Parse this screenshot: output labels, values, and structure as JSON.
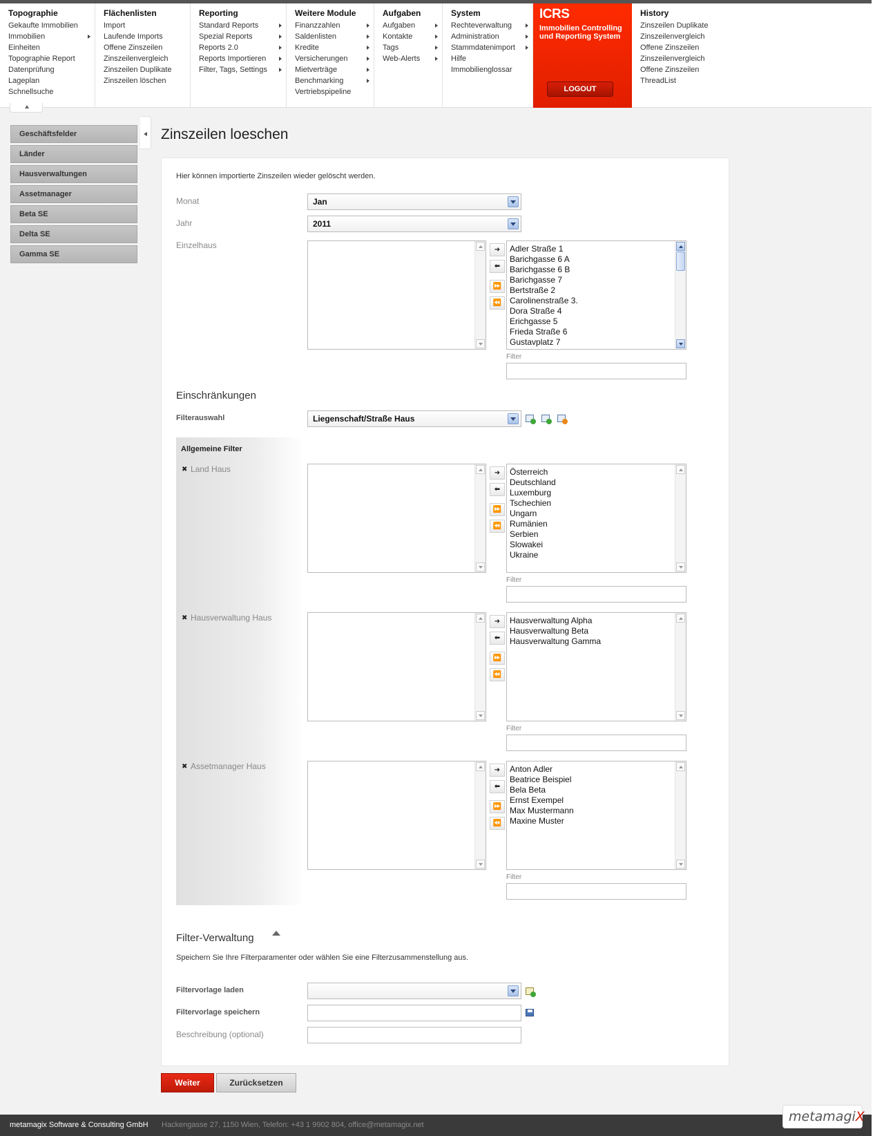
{
  "nav": {
    "columns": [
      {
        "title": "Topographie",
        "items": [
          {
            "label": "Gekaufte Immobilien",
            "sub": false
          },
          {
            "label": "Immobilien",
            "sub": true
          },
          {
            "label": "Einheiten",
            "sub": false
          },
          {
            "label": "Topographie Report",
            "sub": false
          },
          {
            "label": "Datenprüfung",
            "sub": false
          },
          {
            "label": "Lageplan",
            "sub": false
          },
          {
            "label": "Schnellsuche",
            "sub": false
          }
        ]
      },
      {
        "title": "Flächenlisten",
        "items": [
          {
            "label": "Import",
            "sub": false
          },
          {
            "label": "Laufende Imports",
            "sub": false
          },
          {
            "label": "Offene Zinszeilen",
            "sub": false
          },
          {
            "label": "Zinszeilenvergleich",
            "sub": false
          },
          {
            "label": "Zinszeilen Duplikate",
            "sub": false
          },
          {
            "label": "Zinszeilen löschen",
            "sub": false
          }
        ]
      },
      {
        "title": "Reporting",
        "items": [
          {
            "label": "Standard Reports",
            "sub": true
          },
          {
            "label": "Spezial Reports",
            "sub": true
          },
          {
            "label": "Reports 2.0",
            "sub": true
          },
          {
            "label": "Reports Importieren",
            "sub": true
          },
          {
            "label": "Filter, Tags, Settings",
            "sub": true
          }
        ]
      },
      {
        "title": "Weitere Module",
        "items": [
          {
            "label": "Finanzzahlen",
            "sub": true
          },
          {
            "label": "Saldenlisten",
            "sub": true
          },
          {
            "label": "Kredite",
            "sub": true
          },
          {
            "label": "Versicherungen",
            "sub": true
          },
          {
            "label": "Mietverträge",
            "sub": true
          },
          {
            "label": "Benchmarking",
            "sub": true
          },
          {
            "label": "Vertriebspipeline",
            "sub": false
          }
        ]
      },
      {
        "title": "Aufgaben",
        "items": [
          {
            "label": "Aufgaben",
            "sub": true
          },
          {
            "label": "Kontakte",
            "sub": true
          },
          {
            "label": "Tags",
            "sub": true
          },
          {
            "label": "Web-Alerts",
            "sub": true
          }
        ]
      },
      {
        "title": "System",
        "items": [
          {
            "label": "Rechteverwaltung",
            "sub": true
          },
          {
            "label": "Administration",
            "sub": true
          },
          {
            "label": "Stammdatenimport",
            "sub": true
          },
          {
            "label": "Hilfe",
            "sub": false
          },
          {
            "label": "Immobilienglossar",
            "sub": false
          }
        ]
      }
    ],
    "icrs": {
      "brand": "ICRS",
      "subtitle_line1": "Immobilien Controlling",
      "subtitle_line2": "und Reporting System",
      "logout": "LOGOUT"
    },
    "history": {
      "title": "History",
      "items": [
        "Zinszeilen Duplikate",
        "Zinszeilenvergleich",
        "Offene Zinszeilen",
        "Zinszeilenvergleich",
        "Offene Zinszeilen",
        "ThreadList"
      ]
    }
  },
  "sidebar": {
    "items": [
      "Geschäftsfelder",
      "Länder",
      "Hausverwaltungen",
      "Assetmanager",
      "Beta SE",
      "Delta SE",
      "Gamma SE"
    ]
  },
  "page": {
    "title": "Zinszeilen loeschen",
    "intro": "Hier können importierte Zinszeilen wieder gelöscht werden.",
    "monat": {
      "label": "Monat",
      "value": "Jan"
    },
    "jahr": {
      "label": "Jahr",
      "value": "2011"
    },
    "einzelhaus": {
      "label": "Einzelhaus",
      "available": [
        "Adler Straße 1",
        "Barichgasse 6 A",
        "Barichgasse 6 B",
        "Barichgasse 7",
        "Bertstraße 2",
        "Carolinenstraße 3.",
        "Dora Straße 4",
        "Erichgasse 5",
        "Frieda Straße 6",
        "Gustavplatz 7"
      ]
    },
    "filter_label": "Filter",
    "transfer_buttons": {
      "add": "➜",
      "remove": "⬅",
      "add_all": "⏩",
      "remove_all": "⏪"
    },
    "einschraenkungen": {
      "title": "Einschränkungen",
      "filterauswahl_label": "Filterauswahl",
      "filterauswahl_value": "Liegenschaft/Straße Haus"
    },
    "allgemeine_filter": {
      "title": "Allgemeine Filter",
      "land": {
        "label": "Land Haus",
        "available": [
          "Österreich",
          "Deutschland",
          "Luxemburg",
          "Tschechien",
          "Ungarn",
          "Rumänien",
          "Serbien",
          "Slowakei",
          "Ukraine"
        ]
      },
      "hausverwaltung": {
        "label": "Hausverwaltung Haus",
        "available": [
          "Hausverwaltung Alpha",
          "Hausverwaltung Beta",
          "Hausverwaltung Gamma"
        ]
      },
      "assetmanager": {
        "label": "Assetmanager Haus",
        "available": [
          "Anton Adler",
          "Beatrice Beispiel",
          "Bela Beta",
          "Ernst Exempel",
          "Max Mustermann",
          "Maxine Muster"
        ]
      }
    },
    "filterverwaltung": {
      "title": "Filter-Verwaltung",
      "intro": "Speichern Sie Ihre Filterparamenter oder wählen Sie eine Filterzusammenstellung aus.",
      "laden_label": "Filtervorlage laden",
      "speichern_label": "Filtervorlage speichern",
      "beschreibung_label": "Beschreibung (optional)"
    },
    "buttons": {
      "weiter": "Weiter",
      "reset": "Zurücksetzen"
    }
  },
  "footer": {
    "company": "metamagix Software & Consulting GmbH",
    "address": "Hackengasse 27, 1150 Wien, Telefon: +43 1 9902 804, office@metamagix.net",
    "logo_main": "metamagi",
    "logo_accent": "X"
  },
  "colors": {
    "accent": "#e01e00",
    "sidebar": "#bdbdbd",
    "footer": "#3a3a3a"
  }
}
